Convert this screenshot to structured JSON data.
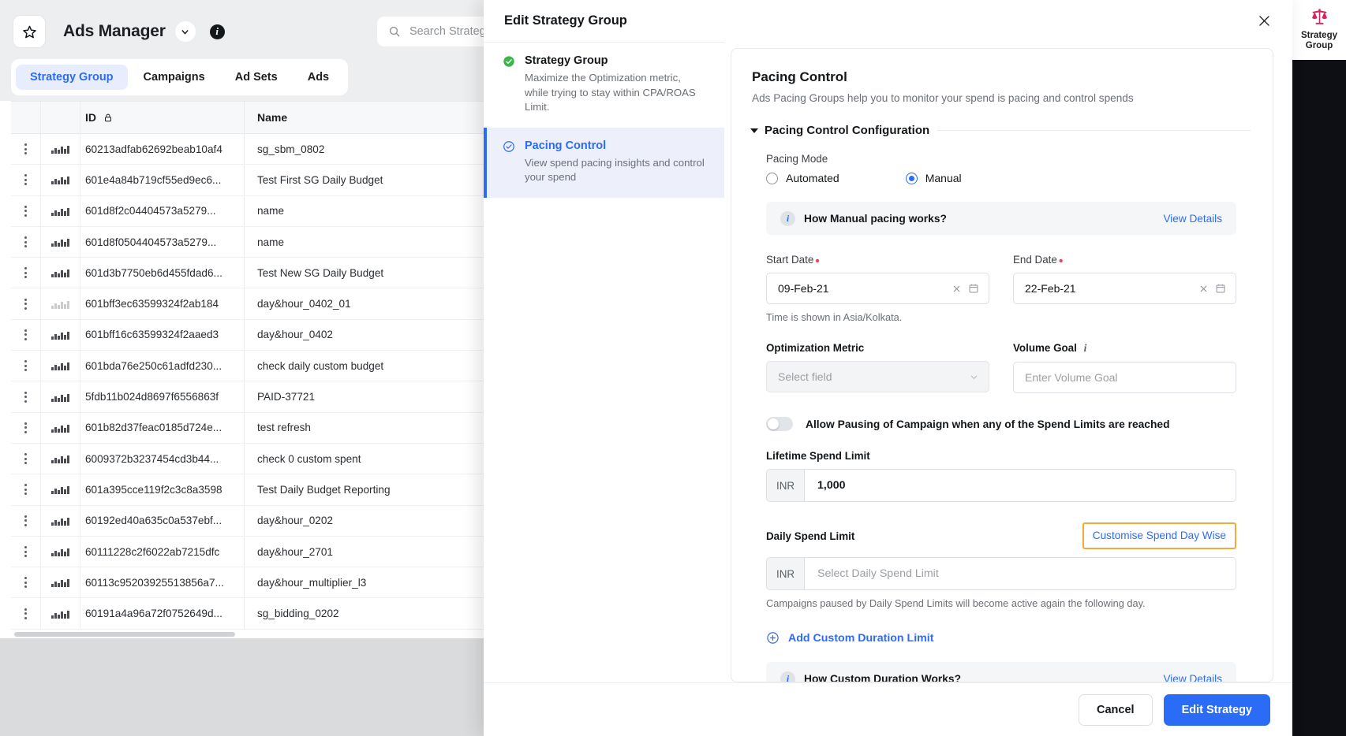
{
  "topbar": {
    "star_icon": "star-icon",
    "app_title": "Ads Manager",
    "caret_icon": "chevron-down-icon",
    "info_icon": "info-icon",
    "search_placeholder": "Search Strategy",
    "search_icon": "search-icon"
  },
  "tabs": [
    {
      "label": "Strategy Group",
      "active": true
    },
    {
      "label": "Campaigns",
      "active": false
    },
    {
      "label": "Ad Sets",
      "active": false
    },
    {
      "label": "Ads",
      "active": false
    }
  ],
  "table": {
    "columns": [
      "",
      "",
      "ID",
      "Name"
    ],
    "id_header": "ID",
    "id_lock_icon": "lock-icon",
    "name_header": "Name",
    "row_menu_icon": "kebab-menu-icon",
    "row_chart_icon": "bar-chart-icon",
    "rows": [
      {
        "id": "60213adfab62692beab10af4",
        "name": "sg_sbm_0802",
        "chart_dim": false
      },
      {
        "id": "601e4a84b719cf55ed9ec6...",
        "name": "Test First SG Daily Budget",
        "chart_dim": false
      },
      {
        "id": "601d8f2c04404573a5279...",
        "name": "name",
        "chart_dim": false
      },
      {
        "id": "601d8f0504404573a5279...",
        "name": "name",
        "chart_dim": false
      },
      {
        "id": "601d3b7750eb6d455fdad6...",
        "name": "Test New SG Daily Budget",
        "chart_dim": false
      },
      {
        "id": "601bff3ec63599324f2ab184",
        "name": "day&hour_0402_01",
        "chart_dim": true
      },
      {
        "id": "601bff16c63599324f2aaed3",
        "name": "day&hour_0402",
        "chart_dim": false
      },
      {
        "id": "601bda76e250c61adfd230...",
        "name": "check daily custom budget",
        "chart_dim": false
      },
      {
        "id": "5fdb11b024d8697f6556863f",
        "name": "PAID-37721",
        "chart_dim": false
      },
      {
        "id": "601b82d37feac0185d724e...",
        "name": "test refresh",
        "chart_dim": false
      },
      {
        "id": "6009372b3237454cd3b44...",
        "name": "check 0 custom spent",
        "chart_dim": false
      },
      {
        "id": "601a395cce119f2c3c8a3598",
        "name": "Test Daily Budget Reporting",
        "chart_dim": false
      },
      {
        "id": "60192ed40a635c0a537ebf...",
        "name": "day&hour_0202",
        "chart_dim": false
      },
      {
        "id": "60111228c2f6022ab7215dfc",
        "name": "day&hour_2701",
        "chart_dim": false
      },
      {
        "id": "60113c95203925513856a7...",
        "name": "day&hour_multiplier_l3",
        "chart_dim": false
      },
      {
        "id": "60191a4a96a72f0752649d...",
        "name": "sg_bidding_0202",
        "chart_dim": false
      }
    ]
  },
  "rail": {
    "icon": "scales-balance-icon",
    "label_line1": "Strategy",
    "label_line2": "Group",
    "icon_color": "#d6255b"
  },
  "modal": {
    "title": "Edit Strategy Group",
    "close_icon": "close-icon",
    "steps": [
      {
        "name": "Strategy Group",
        "desc": "Maximize the Optimization metric, while trying to stay within CPA/ROAS Limit.",
        "status_icon": "check-filled-icon",
        "active": false
      },
      {
        "name": "Pacing Control",
        "desc": "View spend pacing insights and control your spend",
        "status_icon": "check-outline-icon",
        "active": true
      }
    ],
    "panel": {
      "title": "Pacing Control",
      "subtitle": "Ads Pacing Groups help you to monitor your spend is pacing and control spends",
      "section_title": "Pacing Control Configuration",
      "collapse_icon": "triangle-down-icon",
      "pacing_mode_label": "Pacing Mode",
      "pacing_modes": [
        {
          "label": "Automated",
          "selected": false
        },
        {
          "label": "Manual",
          "selected": true
        }
      ],
      "manual_banner": {
        "icon": "info-icon",
        "text": "How Manual pacing works?",
        "link": "View Details"
      },
      "start_date": {
        "label": "Start Date",
        "required": true,
        "value": "09-Feb-21",
        "clear_icon": "close-icon",
        "calendar_icon": "calendar-icon"
      },
      "end_date": {
        "label": "End Date",
        "required": true,
        "value": "22-Feb-21",
        "clear_icon": "close-icon",
        "calendar_icon": "calendar-icon"
      },
      "timezone_hint": "Time is shown in Asia/Kolkata.",
      "optimization_metric": {
        "label": "Optimization Metric",
        "placeholder": "Select field",
        "chevron_icon": "chevron-down-icon",
        "disabled": true
      },
      "volume_goal": {
        "label": "Volume Goal",
        "info_icon": "info-icon",
        "placeholder": "Enter Volume Goal"
      },
      "allow_pausing": {
        "label": "Allow Pausing of Campaign when any of the Spend Limits are reached",
        "enabled": false
      },
      "lifetime_spend_limit": {
        "label": "Lifetime Spend Limit",
        "currency": "INR",
        "value": "1,000"
      },
      "daily_spend_limit": {
        "label": "Daily Spend Limit",
        "currency": "INR",
        "placeholder": "Select Daily Spend Limit",
        "customise_link": "Customise Spend Day Wise",
        "customise_link_highlight": "#f0a93a",
        "hint": "Campaigns paused by Daily Spend Limits will become active again the following day."
      },
      "add_custom_duration": {
        "icon": "plus-circle-icon",
        "label": "Add Custom Duration Limit"
      },
      "custom_duration_banner": {
        "icon": "info-icon",
        "text": "How Custom Duration Works?",
        "link": "View Details"
      }
    },
    "footer": {
      "cancel_label": "Cancel",
      "submit_label": "Edit Strategy"
    }
  },
  "colors": {
    "accent_blue": "#2b6cf6",
    "highlight_orange": "#f0a93a",
    "success_green": "#3bb54a",
    "required_red": "#f0444c"
  }
}
